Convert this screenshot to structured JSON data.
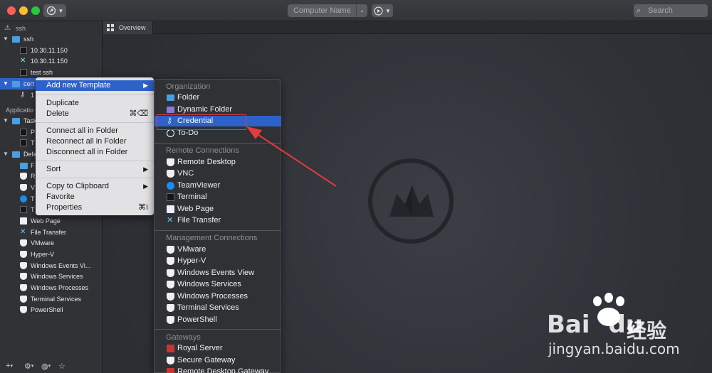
{
  "toolbar": {
    "computer_name_placeholder": "Computer Name",
    "search_placeholder": "Search"
  },
  "sidebar": {
    "header_ssh": "ssh",
    "folder_ssh": "ssh",
    "ssh_items": [
      "10.30.11.150",
      "10.30.11.150",
      "test ssh"
    ],
    "folder_cert": "cert",
    "cert_child": "1",
    "section_applications": "Applicatio",
    "folder_tasks": "Task",
    "task_items": [
      "P",
      "T"
    ],
    "folder_defaults": "Defa",
    "default_partial_items": [
      "F",
      "R",
      "V",
      "T",
      "T"
    ],
    "default_items": [
      "Web Page",
      "File Transfer",
      "VMware",
      "Hyper-V",
      "Windows Events Vi...",
      "Windows Services",
      "Windows Processes",
      "Terminal Services",
      "PowerShell"
    ]
  },
  "tabs": {
    "overview": "Overview"
  },
  "context_menu": {
    "add_new_template": "Add new Template",
    "duplicate": "Duplicate",
    "delete": "Delete",
    "delete_shortcut": "⌘⌫",
    "connect_all": "Connect all in Folder",
    "reconnect_all": "Reconnect all in Folder",
    "disconnect_all": "Disconnect all in Folder",
    "sort": "Sort",
    "copy_to_clipboard": "Copy to Clipboard",
    "favorite": "Favorite",
    "properties": "Properties",
    "properties_shortcut": "⌘I"
  },
  "submenu": {
    "organization_header": "Organization",
    "folder": "Folder",
    "dynamic_folder": "Dynamic Folder",
    "credential": "Credential",
    "todo": "To-Do",
    "remote_header": "Remote Connections",
    "remote_desktop": "Remote Desktop",
    "vnc": "VNC",
    "teamviewer": "TeamViewer",
    "terminal": "Terminal",
    "web_page": "Web Page",
    "file_transfer": "File Transfer",
    "management_header": "Management Connections",
    "vmware": "VMware",
    "hyperv": "Hyper-V",
    "windows_events_view": "Windows Events View",
    "windows_services": "Windows Services",
    "windows_processes": "Windows Processes",
    "terminal_services": "Terminal Services",
    "powershell": "PowerShell",
    "gateways_header": "Gateways",
    "royal_server": "Royal Server",
    "secure_gateway": "Secure Gateway",
    "remote_desktop_gateway": "Remote Desktop Gateway"
  },
  "watermark": {
    "brand_bai": "Bai",
    "brand_du": "du",
    "brand_cn": "经验",
    "url": "jingyan.baidu.com"
  },
  "colors": {
    "selection": "#2f62c8",
    "annotation": "#e43b3b"
  }
}
